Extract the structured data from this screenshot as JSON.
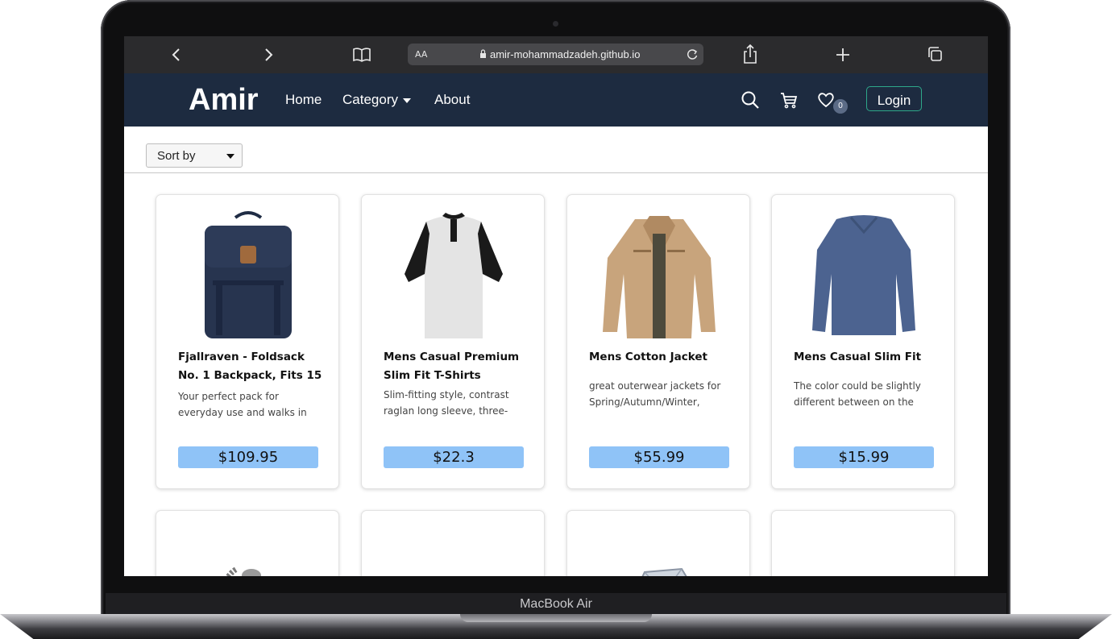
{
  "device": {
    "label": "MacBook Air"
  },
  "browser": {
    "text_size_label": "AA",
    "address": "amir-mohammadzadeh.github.io"
  },
  "site": {
    "logo": "Amir",
    "nav": {
      "home": "Home",
      "category": "Category",
      "about": "About"
    },
    "wishlist_count": "0",
    "login_label": "Login"
  },
  "filters": {
    "sort_label": "Sort by"
  },
  "products": [
    {
      "title": "Fjallraven - Foldsack No. 1 Backpack, Fits 15",
      "description": "Your perfect pack for everyday use and walks in",
      "price": "$109.95"
    },
    {
      "title": "Mens Casual Premium Slim Fit T-Shirts",
      "description": "Slim-fitting style, contrast raglan long sleeve, three-",
      "price": "$22.3"
    },
    {
      "title": "Mens Cotton Jacket",
      "description": "great outerwear jackets for Spring/Autumn/Winter,",
      "price": "$55.99"
    },
    {
      "title": "Mens Casual Slim Fit",
      "description": "The color could be slightly different between on the",
      "price": "$15.99"
    }
  ],
  "colors": {
    "navbar": "#1d2b40",
    "price_bg": "#8fc3f7",
    "login_border": "#2ea88a"
  }
}
